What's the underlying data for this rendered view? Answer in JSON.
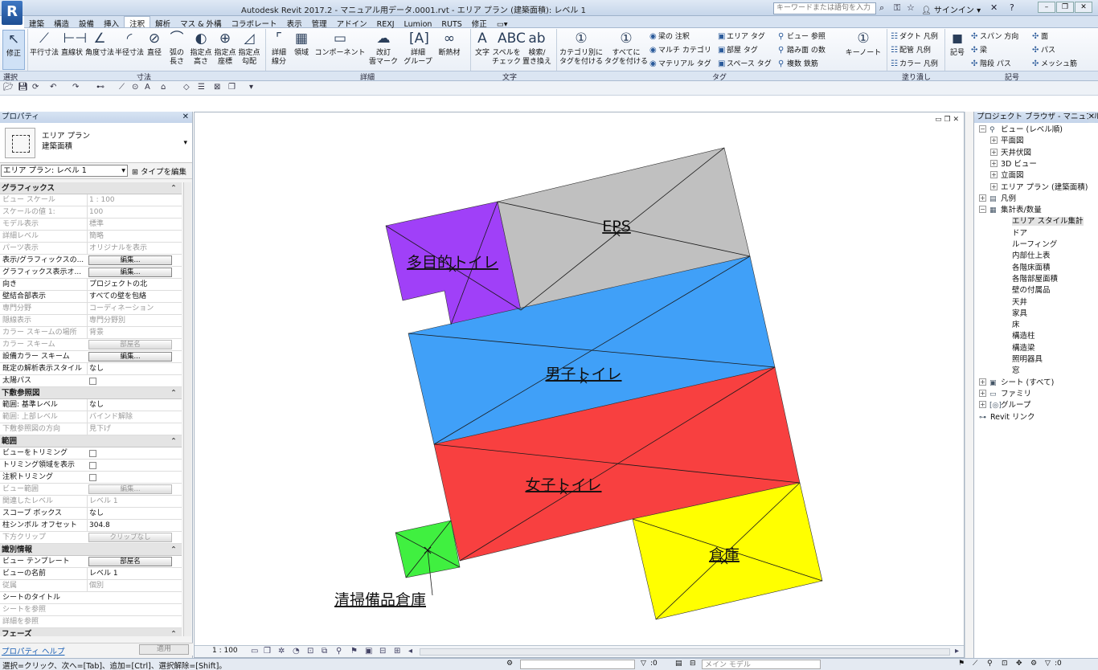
{
  "app": {
    "logo": "R",
    "window_title": "Autodesk Revit 2017.2 -   マニュアル用データ.0001.rvt - エリア プラン (建築面積): レベル 1",
    "search_placeholder": "キーワードまたは語句を入力",
    "signin": "サインイン",
    "help": "?"
  },
  "menu_tabs": [
    "建築",
    "構造",
    "設備",
    "挿入",
    "注釈",
    "解析",
    "マス & 外構",
    "コラボレート",
    "表示",
    "管理",
    "アドイン",
    "REXJ",
    "Lumion",
    "RUTS",
    "修正"
  ],
  "active_tab": "注釈",
  "ribbon": {
    "modify": {
      "label": "修正"
    },
    "dimension": [
      {
        "label": "平行寸法",
        "icon": "⟋"
      },
      {
        "label": "直線状",
        "icon": "⊢⊣"
      },
      {
        "label": "角度寸法",
        "icon": "∠"
      },
      {
        "label": "半径寸法",
        "icon": "◜"
      },
      {
        "label": "直径",
        "icon": "⊘"
      },
      {
        "label": "弧の\n長さ",
        "icon": "⌒"
      },
      {
        "label": "指定点\n高さ",
        "icon": "◐"
      },
      {
        "label": "指定点\n座標",
        "icon": "⊕"
      },
      {
        "label": "指定点\n勾配",
        "icon": "◿"
      }
    ],
    "detail": [
      {
        "label": "詳細\n線分",
        "icon": "⌜"
      },
      {
        "label": "領域",
        "icon": "▦"
      },
      {
        "label": "コンポーネント",
        "icon": "▭"
      },
      {
        "label": "改訂\n雲マーク",
        "icon": "☁"
      },
      {
        "label": "詳細\nグループ",
        "icon": "[A]"
      },
      {
        "label": "断熱材",
        "icon": "∞"
      }
    ],
    "text": [
      {
        "label": "文字",
        "icon": "A"
      },
      {
        "label": "スペルを\nチェック",
        "icon": "ABC"
      },
      {
        "label": "検索/\n置き換え",
        "icon": "ab"
      }
    ],
    "tag": [
      {
        "label": "カテゴリ別に\nタグを付ける",
        "icon": "①"
      },
      {
        "label": "すべてに\nタグを付ける",
        "icon": "①"
      }
    ],
    "tag_small": [
      "梁の 注釈",
      "マルチ カテゴリ",
      "マテリアル タグ",
      "エリア タグ",
      "部屋 タグ",
      "スペース タグ",
      "ビュー 参照",
      "踏み面 の数",
      "複数 鉄筋"
    ],
    "keynote": {
      "label": "キーノート",
      "icon": "①"
    },
    "fill": [
      "ダクト 凡例",
      "配管 凡例",
      "カラー 凡例"
    ],
    "symbol": {
      "label": "記号",
      "icon": "◼"
    },
    "symbol_small": [
      "スパン 方向",
      "面",
      "梁",
      "パス",
      "階段 パス",
      "メッシュ筋"
    ],
    "panels": [
      "選択",
      "寸法",
      "詳細",
      "文字",
      "タグ",
      "塗り潰し",
      "記号"
    ]
  },
  "properties": {
    "header": "プロパティ",
    "type_name": "エリア プラン",
    "type_sub": "建築面積",
    "filter": "エリア プラン: レベル 1",
    "edit_type": "タイプを編集",
    "groups": [
      {
        "name": "グラフィックス",
        "rows": [
          {
            "label": "ビュー スケール",
            "value": "1 : 100",
            "dim": true
          },
          {
            "label": "スケールの値    1:",
            "value": "100",
            "dim": true
          },
          {
            "label": "モデル表示",
            "value": "標準",
            "dim": true
          },
          {
            "label": "詳細レベル",
            "value": "簡略",
            "dim": true
          },
          {
            "label": "パーツ表示",
            "value": "オリジナルを表示",
            "dim": true
          },
          {
            "label": "表示/グラフィックスの...",
            "value": "編集...",
            "btn": true
          },
          {
            "label": "グラフィックス表示オ...",
            "value": "編集...",
            "btn": true
          },
          {
            "label": "向き",
            "value": "プロジェクトの北"
          },
          {
            "label": "壁結合部表示",
            "value": "すべての壁を包絡"
          },
          {
            "label": "専門分野",
            "value": "コーディネーション",
            "dim": true
          },
          {
            "label": "隠線表示",
            "value": "専門分野別",
            "dim": true
          },
          {
            "label": "カラー スキームの場所",
            "value": "背景",
            "dim": true
          },
          {
            "label": "カラー スキーム",
            "value": "部屋名",
            "btn": true,
            "dim": true
          },
          {
            "label": "設備カラー スキーム",
            "value": "編集...",
            "btn": true
          },
          {
            "label": "既定の解析表示スタイル",
            "value": "なし"
          },
          {
            "label": "太陽パス",
            "value": "",
            "check": true
          }
        ]
      },
      {
        "name": "下敷参照図",
        "rows": [
          {
            "label": "範囲: 基準レベル",
            "value": "なし"
          },
          {
            "label": "範囲: 上部レベル",
            "value": "バインド解除",
            "dim": true
          },
          {
            "label": "下敷参照図の方向",
            "value": "見下げ",
            "dim": true
          }
        ]
      },
      {
        "name": "範囲",
        "rows": [
          {
            "label": "ビューをトリミング",
            "value": "",
            "check": true
          },
          {
            "label": "トリミング領域を表示",
            "value": "",
            "check": true
          },
          {
            "label": "注釈トリミング",
            "value": "",
            "check": true
          },
          {
            "label": "ビュー範囲",
            "value": "編集...",
            "btn": true,
            "dim": true
          },
          {
            "label": "関連したレベル",
            "value": "レベル 1",
            "dim": true
          },
          {
            "label": "スコープ ボックス",
            "value": "なし"
          },
          {
            "label": "柱シンボル オフセット",
            "value": "304.8"
          },
          {
            "label": "下方クリップ",
            "value": "クリップなし",
            "btn": true,
            "dim": true
          }
        ]
      },
      {
        "name": "識別情報",
        "rows": [
          {
            "label": "ビュー テンプレート",
            "value": "部屋名",
            "btn": true
          },
          {
            "label": "ビューの名前",
            "value": "レベル 1"
          },
          {
            "label": "従属",
            "value": "個別",
            "dim": true
          },
          {
            "label": "シートのタイトル",
            "value": ""
          },
          {
            "label": "シートを参照",
            "value": "",
            "dim": true
          },
          {
            "label": "詳細を参照",
            "value": "",
            "dim": true
          }
        ]
      },
      {
        "name": "フェーズ",
        "rows": []
      }
    ],
    "help": "プロパティ ヘルプ",
    "apply": "適用"
  },
  "viewport": {
    "scale": "1 : 100",
    "colors": {
      "purple": "#a040f8",
      "gray": "#c0c0c0",
      "blue": "#40a0f8",
      "red": "#f84040",
      "green": "#40f040",
      "yellow": "#ffff00"
    },
    "rooms": [
      {
        "name": "多目的トイレ"
      },
      {
        "name": "EPS"
      },
      {
        "name": "男子トイレ"
      },
      {
        "name": "女子トイレ"
      },
      {
        "name": "倉庫"
      },
      {
        "name": "清掃備品倉庫"
      }
    ]
  },
  "browser": {
    "header": "プロジェクト ブラウザ - マニュアル用データ",
    "nodes": [
      {
        "label": "ビュー (レベル順)",
        "level": 0,
        "exp": "−",
        "icon": "⚲"
      },
      {
        "label": "平面図",
        "level": 1,
        "exp": "+"
      },
      {
        "label": "天井伏図",
        "level": 1,
        "exp": "+"
      },
      {
        "label": "3D ビュー",
        "level": 1,
        "exp": "+"
      },
      {
        "label": "立面図",
        "level": 1,
        "exp": "+"
      },
      {
        "label": "エリア プラン (建築面積)",
        "level": 1,
        "exp": "+"
      },
      {
        "label": "凡例",
        "level": 0,
        "exp": "+",
        "icon": "▤"
      },
      {
        "label": "集計表/数量",
        "level": 0,
        "exp": "−",
        "icon": "▦"
      },
      {
        "label": "エリア スタイル集計",
        "level": 2,
        "sel": true
      },
      {
        "label": "ドア",
        "level": 2
      },
      {
        "label": "ルーフィング",
        "level": 2
      },
      {
        "label": "内部仕上表",
        "level": 2
      },
      {
        "label": "各階床面積",
        "level": 2
      },
      {
        "label": "各階部屋面積",
        "level": 2
      },
      {
        "label": "壁の付属品",
        "level": 2
      },
      {
        "label": "天井",
        "level": 2
      },
      {
        "label": "家具",
        "level": 2
      },
      {
        "label": "床",
        "level": 2
      },
      {
        "label": "構造柱",
        "level": 2
      },
      {
        "label": "構造梁",
        "level": 2
      },
      {
        "label": "照明器具",
        "level": 2
      },
      {
        "label": "窓",
        "level": 2
      },
      {
        "label": "シート (すべて)",
        "level": 0,
        "exp": "+",
        "icon": "▣"
      },
      {
        "label": "ファミリ",
        "level": 0,
        "exp": "+",
        "icon": "▭"
      },
      {
        "label": "グループ",
        "level": 0,
        "exp": "+",
        "icon": "[◎]"
      },
      {
        "label": "Revit リンク",
        "level": 0,
        "icon": "⊶"
      }
    ]
  },
  "status": {
    "text": "選択=クリック、次へ=[Tab]、追加=[Ctrl]、選択解除=[Shift]。",
    "workset_count": ":0",
    "model": "メイン モデル",
    "filter_count": ":0"
  }
}
